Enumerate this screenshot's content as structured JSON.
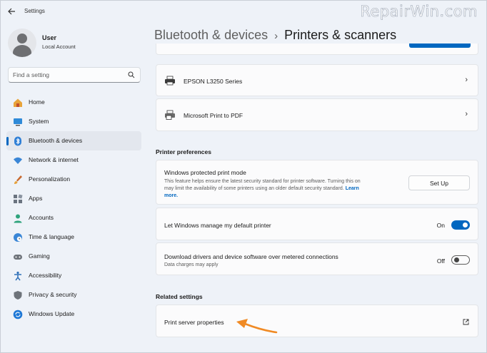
{
  "window": {
    "title": "Settings",
    "watermark": "RepairWin.com"
  },
  "user": {
    "name": "User",
    "account": "Local Account"
  },
  "search": {
    "placeholder": "Find a setting"
  },
  "sidebar": {
    "items": [
      {
        "label": "Home",
        "icon": "home-icon",
        "active": false
      },
      {
        "label": "System",
        "icon": "system-icon",
        "active": false
      },
      {
        "label": "Bluetooth & devices",
        "icon": "bluetooth-icon",
        "active": true
      },
      {
        "label": "Network & internet",
        "icon": "wifi-icon",
        "active": false
      },
      {
        "label": "Personalization",
        "icon": "brush-icon",
        "active": false
      },
      {
        "label": "Apps",
        "icon": "apps-icon",
        "active": false
      },
      {
        "label": "Accounts",
        "icon": "accounts-icon",
        "active": false
      },
      {
        "label": "Time & language",
        "icon": "globe-clock-icon",
        "active": false
      },
      {
        "label": "Gaming",
        "icon": "gamepad-icon",
        "active": false
      },
      {
        "label": "Accessibility",
        "icon": "accessibility-icon",
        "active": false
      },
      {
        "label": "Privacy & security",
        "icon": "shield-icon",
        "active": false
      },
      {
        "label": "Windows Update",
        "icon": "update-icon",
        "active": false
      }
    ]
  },
  "header": {
    "parent": "Bluetooth & devices",
    "separator": "›",
    "current": "Printers & scanners"
  },
  "printers": [
    {
      "name": "EPSON L3250 Series",
      "icon": "printer-icon"
    },
    {
      "name": "Microsoft Print to PDF",
      "icon": "pdf-printer-icon"
    }
  ],
  "preferences": {
    "title": "Printer preferences",
    "protected_mode": {
      "label": "Windows protected print mode",
      "desc_line1": "This feature helps ensure the latest security standard for printer software. Turning this on",
      "desc_line2": "may limit the availability of some printers using an older default security standard.",
      "learn_more_1": "Learn",
      "learn_more_2": "more.",
      "button": "Set Up"
    },
    "manage_default": {
      "label": "Let Windows manage my default printer",
      "state": "On",
      "on": true
    },
    "metered": {
      "label": "Download drivers and device software over metered connections",
      "desc": "Data charges may apply",
      "state": "Off",
      "on": false
    }
  },
  "related": {
    "title": "Related settings",
    "print_server": "Print server properties"
  },
  "colors": {
    "accent": "#0067c0",
    "annotation_arrow": "#f08a24"
  }
}
